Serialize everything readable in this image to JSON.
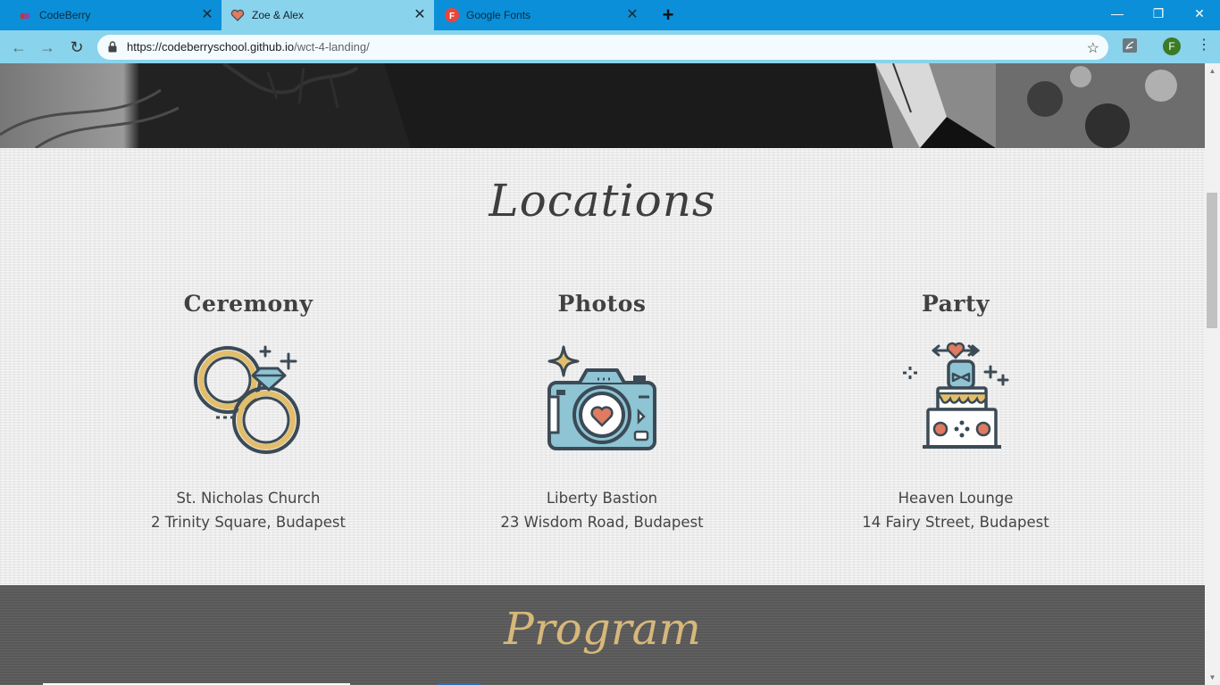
{
  "browser": {
    "tabs": [
      {
        "title": "CodeBerry",
        "active": false
      },
      {
        "title": "Zoe & Alex",
        "active": true
      },
      {
        "title": "Google Fonts",
        "active": false
      }
    ],
    "url_host": "https://codeberryschool.github.io",
    "url_path": "/wct-4-landing/",
    "profile_initial": "F"
  },
  "locations": {
    "title": "Locations",
    "items": [
      {
        "heading": "Ceremony",
        "icon": "wedding-rings-icon",
        "place": "St. Nicholas Church",
        "address": "2 Trinity Square, Budapest"
      },
      {
        "heading": "Photos",
        "icon": "camera-icon",
        "place": "Liberty Bastion",
        "address": "23 Wisdom Road, Budapest"
      },
      {
        "heading": "Party",
        "icon": "wedding-cake-icon",
        "place": "Heaven Lounge",
        "address": "14 Fairy Street, Budapest"
      }
    ]
  },
  "program": {
    "title": "Program"
  },
  "colors": {
    "tabbar": "#0b8fd8",
    "active_tab": "#8ad3ec",
    "accent_gold": "#d7b87a",
    "ring_gold": "#e2be6b",
    "icon_blue": "#8ec4d3",
    "icon_dark": "#3b4a55",
    "heart": "#e07a60"
  }
}
